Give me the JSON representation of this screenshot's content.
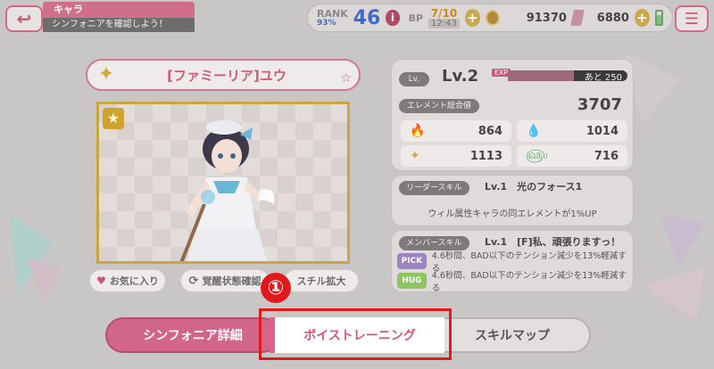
{
  "header": {
    "back_icon": "back-arrow-icon",
    "title": "キャラ",
    "subtitle": "シンフォニアを確認しよう！",
    "menu_icon": "hamburger-menu-icon"
  },
  "status": {
    "rank_label": "RANK",
    "rank_percent": "93%",
    "rank_value": "46",
    "info_label": "i",
    "bp_label": "BP",
    "bp_value": "7/10",
    "bp_timer": "12:43",
    "plus_label": "+",
    "coins": "91370",
    "gems": "6880"
  },
  "character": {
    "name": "[ファミーリア]ユウ"
  },
  "buttons": {
    "favorite": "お気に入り",
    "awakening": "覚醒状態確認",
    "still_zoom": "スチル拡大"
  },
  "stats": {
    "lv_tag": "Lv.",
    "level": "Lv.2",
    "exp_tag": "EXP",
    "exp_remaining": "あと 250",
    "exp_progress": 0.55,
    "element_total_label": "エレメント総合値",
    "element_total": "3707",
    "fire": "864",
    "water": "1014",
    "light": "1113",
    "wind": "716"
  },
  "leader_skill": {
    "tag": "リーダースキル",
    "title": "Lv.1　光のフォース1",
    "description": "ウィル属性キャラの同エレメントが1%UP"
  },
  "member_skill": {
    "tag": "メンバースキル",
    "title": "Lv.1　[F]私、頑張りますっ！",
    "pick_label": "PICK",
    "pick_desc": "4.6秒間、BAD以下のテンション減少を13%軽減する",
    "hug_label": "HUG",
    "hug_desc": "4.6秒間、BAD以下のテンション減少を13%軽減する"
  },
  "tabs": {
    "detail": "シンフォニア詳細",
    "voice_training": "ボイストレーニング",
    "skill_map": "スキルマップ"
  },
  "annotation": {
    "step": "①"
  },
  "colors": {
    "accent_pink": "#d2668a",
    "highlight_red": "#e0191d",
    "gold": "#c9a643"
  }
}
